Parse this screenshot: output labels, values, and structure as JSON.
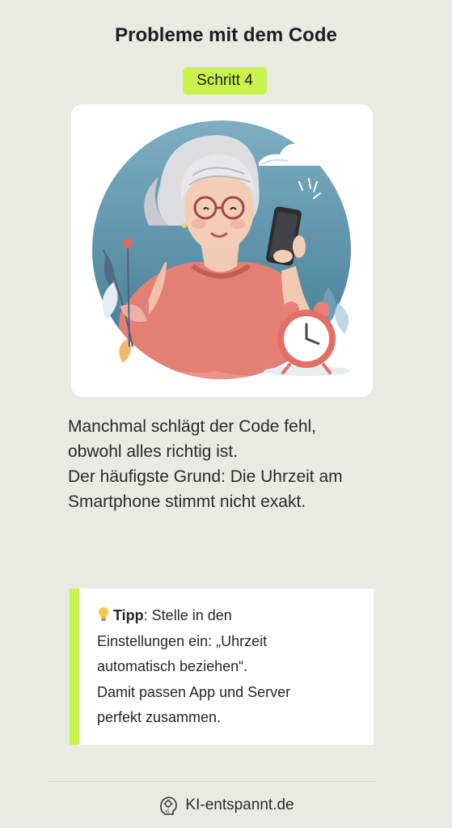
{
  "header": {
    "title": "Probleme mit dem Code",
    "step_badge": "Schritt 4"
  },
  "main": {
    "paragraph_lines": [
      "Manchmal schlägt der Code fehl,",
      "obwohl alles richtig ist.",
      "Der häufigste Grund: Die Uhrzeit am",
      "Smartphone stimmt nicht exakt."
    ]
  },
  "tip": {
    "icon": "lightbulb-icon",
    "label": "Tipp",
    "text_lines": [
      ": Stelle in den",
      "Einstellungen ein: „Uhrzeit",
      "automatisch beziehen“.",
      "Damit passen App und Server",
      "perfekt zusammen."
    ]
  },
  "footer": {
    "logo_text": "KI",
    "site": "KI-entspannt.de"
  },
  "colors": {
    "background": "#e9ebe2",
    "accent": "#c9f24a",
    "card": "#ffffff"
  }
}
